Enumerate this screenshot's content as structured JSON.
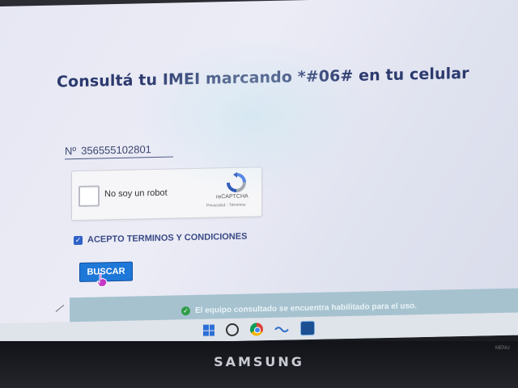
{
  "page": {
    "title": "Consultá tu IMEI marcando *#06# en tu celular"
  },
  "imei": {
    "prefix": "Nº",
    "value": "356555102801"
  },
  "captcha": {
    "label": "No soy un robot",
    "brand": "reCAPTCHA",
    "links": "Privacidad - Términos"
  },
  "terms": {
    "checked": true,
    "label": "ACEPTO TERMINOS Y CONDICIONES"
  },
  "search": {
    "label": "BUSCAR"
  },
  "status": {
    "text": "El equipo consultado se encuentra habilitado para el uso.",
    "color": "#2e9d48"
  },
  "taskbar": {
    "icons": [
      "windows-icon",
      "search-icon",
      "chrome-icon",
      "app-icon",
      "app-icon"
    ]
  },
  "monitor": {
    "brand": "SAMSUNG",
    "button_label": "MENU"
  }
}
